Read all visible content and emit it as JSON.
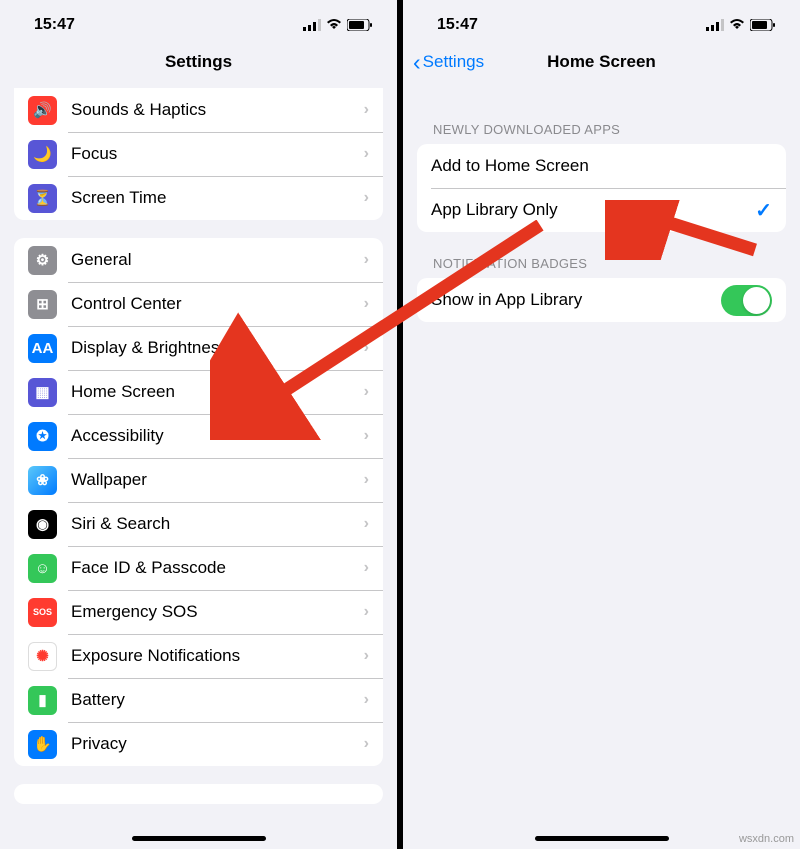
{
  "left": {
    "status": {
      "time": "15:47"
    },
    "title": "Settings",
    "group1": [
      {
        "key": "sounds",
        "label": "Sounds & Haptics",
        "icon": "🔊",
        "color": "ic-red"
      },
      {
        "key": "focus",
        "label": "Focus",
        "icon": "🌙",
        "color": "ic-purple"
      },
      {
        "key": "screen-time",
        "label": "Screen Time",
        "icon": "⏳",
        "color": "ic-purple"
      }
    ],
    "group2": [
      {
        "key": "general",
        "label": "General",
        "icon": "⚙",
        "color": "ic-gray"
      },
      {
        "key": "control-center",
        "label": "Control Center",
        "icon": "⊞",
        "color": "ic-gray"
      },
      {
        "key": "display",
        "label": "Display & Brightness",
        "icon": "AA",
        "color": "ic-blue"
      },
      {
        "key": "home-screen",
        "label": "Home Screen",
        "icon": "▦",
        "color": "ic-indigo"
      },
      {
        "key": "accessibility",
        "label": "Accessibility",
        "icon": "✪",
        "color": "ic-blue"
      },
      {
        "key": "wallpaper",
        "label": "Wallpaper",
        "icon": "❀",
        "color": ""
      },
      {
        "key": "siri",
        "label": "Siri & Search",
        "icon": "◉",
        "color": "ic-black"
      },
      {
        "key": "faceid",
        "label": "Face ID & Passcode",
        "icon": "☺",
        "color": "ic-green"
      },
      {
        "key": "sos",
        "label": "Emergency SOS",
        "icon": "SOS",
        "color": "ic-red2"
      },
      {
        "key": "exposure",
        "label": "Exposure Notifications",
        "icon": "✺",
        "color": ""
      },
      {
        "key": "battery",
        "label": "Battery",
        "icon": "▮",
        "color": "ic-green"
      },
      {
        "key": "privacy",
        "label": "Privacy",
        "icon": "✋",
        "color": "ic-blue"
      }
    ]
  },
  "right": {
    "status": {
      "time": "15:47"
    },
    "back": "Settings",
    "title": "Home Screen",
    "section1_header": "NEWLY DOWNLOADED APPS",
    "section1": [
      {
        "key": "add-home",
        "label": "Add to Home Screen",
        "checked": false
      },
      {
        "key": "app-library",
        "label": "App Library Only",
        "checked": true
      }
    ],
    "section2_header": "NOTIFICATION BADGES",
    "section2": [
      {
        "key": "show-in-lib",
        "label": "Show in App Library",
        "toggle": true
      }
    ]
  },
  "watermark": "wsxdn.com"
}
